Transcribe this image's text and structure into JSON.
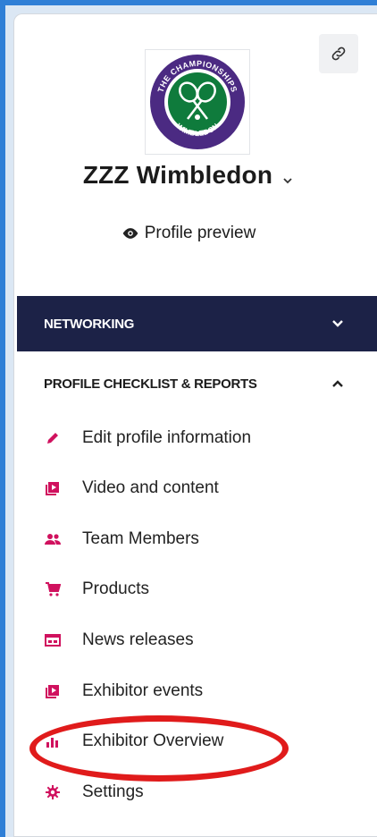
{
  "header": {
    "company_name": "ZZZ Wimbledon",
    "profile_preview_label": "Profile preview",
    "logo_alt": "The Championships Wimbledon logo"
  },
  "logo": {
    "top_text": "THE CHAMPIONSHIPS",
    "bottom_text": "WIMBLEDON"
  },
  "sections": {
    "networking": "NETWORKING",
    "checklist": "PROFILE CHECKLIST & REPORTS"
  },
  "menu": [
    {
      "label": "Edit profile information",
      "icon": "pencil-icon"
    },
    {
      "label": "Video and content",
      "icon": "video-library-icon"
    },
    {
      "label": "Team Members",
      "icon": "people-icon"
    },
    {
      "label": "Products",
      "icon": "cart-icon"
    },
    {
      "label": "News releases",
      "icon": "news-icon"
    },
    {
      "label": "Exhibitor events",
      "icon": "event-icon"
    },
    {
      "label": "Exhibitor Overview",
      "icon": "bar-chart-icon"
    },
    {
      "label": "Settings",
      "icon": "gear-icon"
    }
  ],
  "colors": {
    "accent": "#d0115e",
    "nav_bg": "#1c2247",
    "highlight_ring": "#e01b1b",
    "logo_purple": "#4b2a82",
    "logo_green": "#0f7b3c"
  }
}
